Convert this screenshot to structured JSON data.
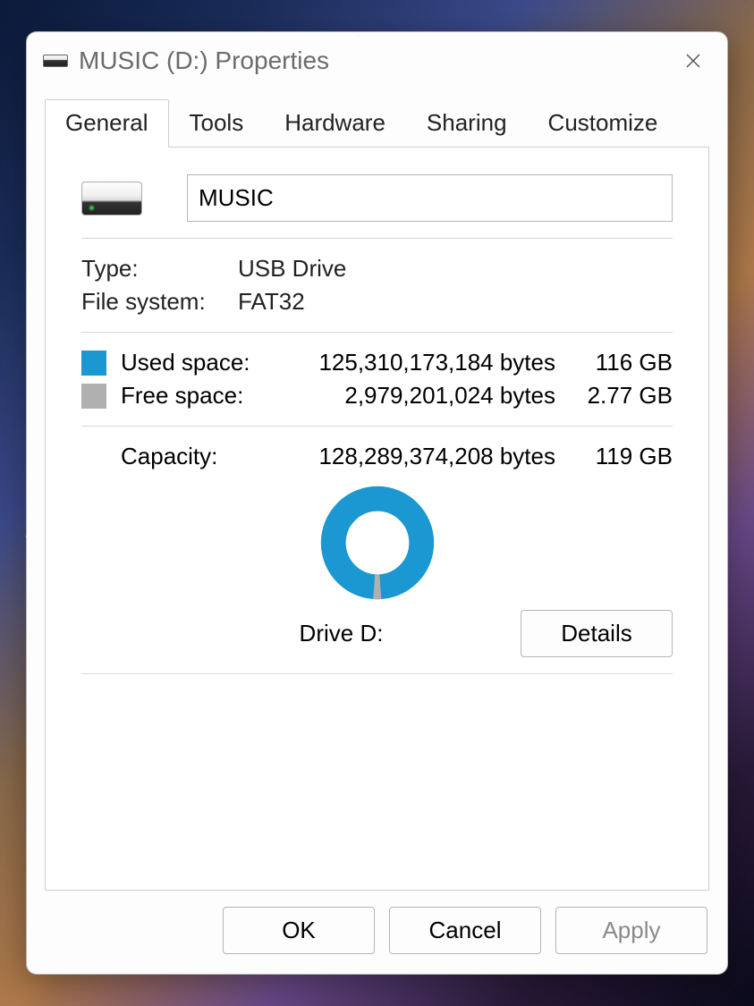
{
  "title": "MUSIC (D:) Properties",
  "tabs": {
    "general": "General",
    "tools": "Tools",
    "hardware": "Hardware",
    "sharing": "Sharing",
    "customize": "Customize"
  },
  "drive_label_value": "MUSIC",
  "type_label": "Type:",
  "type_value": "USB Drive",
  "fs_label": "File system:",
  "fs_value": "FAT32",
  "used_label": "Used space:",
  "used_bytes": "125,310,173,184 bytes",
  "used_gb": "116 GB",
  "free_label": "Free space:",
  "free_bytes": "2,979,201,024 bytes",
  "free_gb": "2.77 GB",
  "capacity_label": "Capacity:",
  "capacity_bytes": "128,289,374,208 bytes",
  "capacity_gb": "119 GB",
  "drive_line": "Drive D:",
  "buttons": {
    "details": "Details",
    "ok": "OK",
    "cancel": "Cancel",
    "apply": "Apply"
  },
  "chart_data": {
    "type": "pie",
    "title": "",
    "series": [
      {
        "name": "Used space",
        "value": 125310173184,
        "color": "#1b97d1"
      },
      {
        "name": "Free space",
        "value": 2979201024,
        "color": "#b0b0b0"
      }
    ]
  },
  "colors": {
    "used": "#1b97d1",
    "free": "#b0b0b0"
  }
}
